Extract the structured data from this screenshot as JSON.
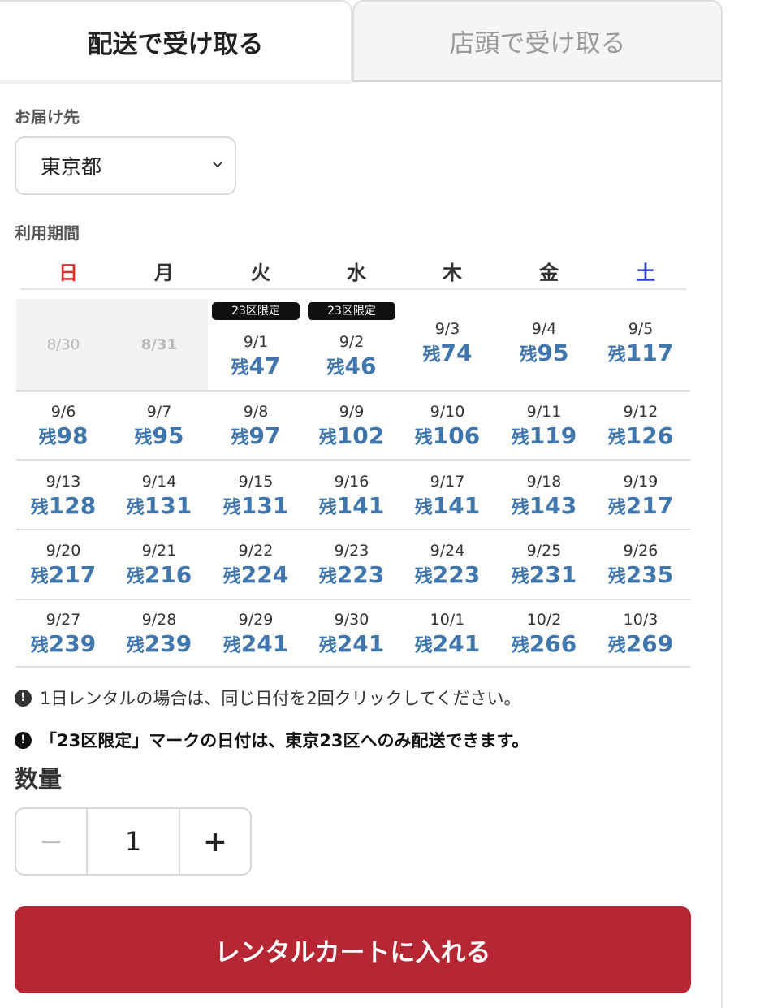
{
  "tabs": [
    {
      "label": "配送で受け取る",
      "active": true
    },
    {
      "label": "店頭で受け取る",
      "active": false
    }
  ],
  "destination": {
    "label": "お届け先",
    "selected": "東京都"
  },
  "period": {
    "label": "利用期間"
  },
  "weekdays": [
    {
      "label": "日",
      "color": "#e03030"
    },
    {
      "label": "月",
      "color": "#333333"
    },
    {
      "label": "火",
      "color": "#333333"
    },
    {
      "label": "水",
      "color": "#333333"
    },
    {
      "label": "木",
      "color": "#333333"
    },
    {
      "label": "金",
      "color": "#333333"
    },
    {
      "label": "土",
      "color": "#2f3fd6"
    }
  ],
  "stock_prefix": "残",
  "badge_label": "23区限定",
  "weeks": [
    [
      {
        "date": "8/30",
        "disabled": true
      },
      {
        "date": "8/31",
        "disabled": true
      },
      {
        "date": "9/1",
        "stock": "47",
        "badge": true
      },
      {
        "date": "9/2",
        "stock": "46",
        "badge": true
      },
      {
        "date": "9/3",
        "stock": "74"
      },
      {
        "date": "9/4",
        "stock": "95"
      },
      {
        "date": "9/5",
        "stock": "117"
      }
    ],
    [
      {
        "date": "9/6",
        "stock": "98"
      },
      {
        "date": "9/7",
        "stock": "95"
      },
      {
        "date": "9/8",
        "stock": "97"
      },
      {
        "date": "9/9",
        "stock": "102"
      },
      {
        "date": "9/10",
        "stock": "106"
      },
      {
        "date": "9/11",
        "stock": "119"
      },
      {
        "date": "9/12",
        "stock": "126"
      }
    ],
    [
      {
        "date": "9/13",
        "stock": "128"
      },
      {
        "date": "9/14",
        "stock": "131"
      },
      {
        "date": "9/15",
        "stock": "131"
      },
      {
        "date": "9/16",
        "stock": "141"
      },
      {
        "date": "9/17",
        "stock": "141"
      },
      {
        "date": "9/18",
        "stock": "143"
      },
      {
        "date": "9/19",
        "stock": "217"
      }
    ],
    [
      {
        "date": "9/20",
        "stock": "217"
      },
      {
        "date": "9/21",
        "stock": "216"
      },
      {
        "date": "9/22",
        "stock": "224"
      },
      {
        "date": "9/23",
        "stock": "223"
      },
      {
        "date": "9/24",
        "stock": "223"
      },
      {
        "date": "9/25",
        "stock": "231"
      },
      {
        "date": "9/26",
        "stock": "235"
      }
    ],
    [
      {
        "date": "9/27",
        "stock": "239"
      },
      {
        "date": "9/28",
        "stock": "239"
      },
      {
        "date": "9/29",
        "stock": "241"
      },
      {
        "date": "9/30",
        "stock": "241"
      },
      {
        "date": "10/1",
        "stock": "241"
      },
      {
        "date": "10/2",
        "stock": "266"
      },
      {
        "date": "10/3",
        "stock": "269"
      }
    ]
  ],
  "notes": [
    {
      "text": "1日レンタルの場合は、同じ日付を2回クリックしてください。",
      "bold": false
    },
    {
      "text": "「23区限定」マークの日付は、東京23区へのみ配送できます。",
      "bold": true
    }
  ],
  "quantity": {
    "label": "数量",
    "value": "1",
    "minus": "−",
    "plus": "+"
  },
  "cart_button": "レンタルカートに入れる",
  "colors": {
    "accent": "#b72633",
    "stock": "#3f76ae",
    "sunday": "#e03030",
    "saturday": "#2f3fd6"
  }
}
